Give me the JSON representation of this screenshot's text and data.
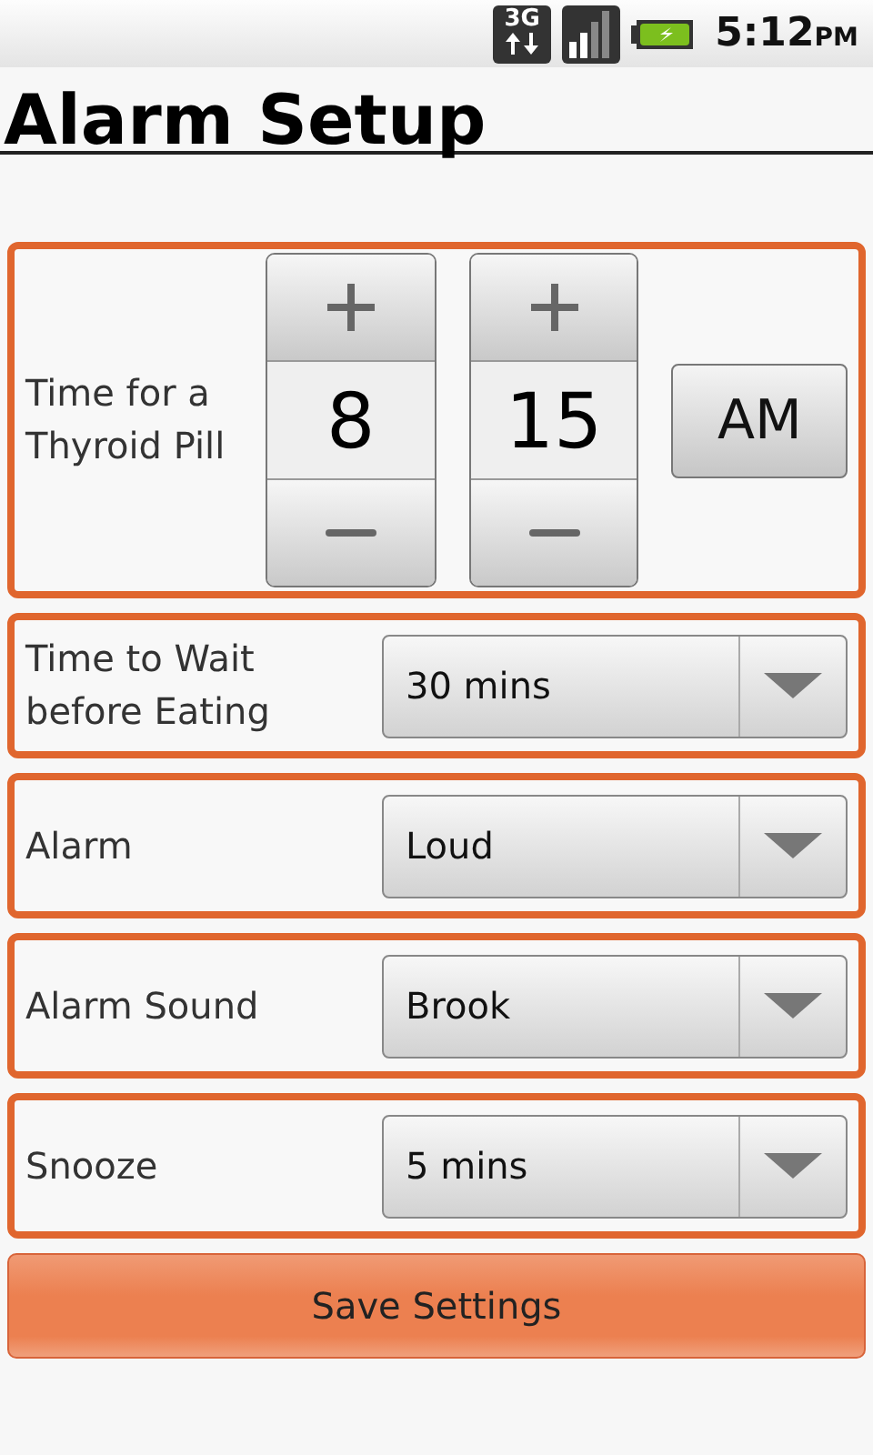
{
  "status_bar": {
    "network_type": "3G",
    "time": "5:12",
    "meridiem": "PM"
  },
  "title": "Alarm Setup",
  "time_setting": {
    "label": "Time for a Thyroid Pill",
    "hour": "8",
    "minute": "15",
    "ampm": "AM"
  },
  "settings": [
    {
      "label": "Time to Wait before Eating",
      "value": "30 mins"
    },
    {
      "label": "Alarm",
      "value": "Loud"
    },
    {
      "label": "Alarm Sound",
      "value": "Brook"
    },
    {
      "label": "Snooze",
      "value": "5 mins"
    }
  ],
  "save_button": "Save Settings"
}
